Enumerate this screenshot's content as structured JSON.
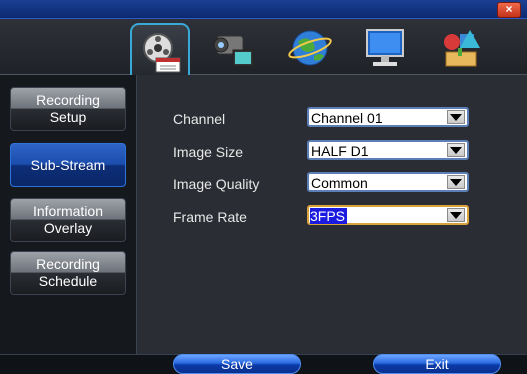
{
  "titlebar": {
    "close_glyph": "×"
  },
  "top_menu": [
    {
      "icon": "record-setup-icon",
      "active": true
    },
    {
      "icon": "camera-icon",
      "active": false
    },
    {
      "icon": "network-globe-icon",
      "active": false
    },
    {
      "icon": "monitor-icon",
      "active": false
    },
    {
      "icon": "tools-icon",
      "active": false
    }
  ],
  "sidebar": {
    "items": [
      {
        "line1": "Recording",
        "line2": "Setup",
        "active": false
      },
      {
        "line1": "Sub-Stream",
        "line2": "",
        "active": true
      },
      {
        "line1": "Information",
        "line2": "Overlay",
        "active": false
      },
      {
        "line1": "Recording",
        "line2": "Schedule",
        "active": false
      }
    ]
  },
  "form": {
    "rows": [
      {
        "label": "Channel",
        "value": "Channel 01"
      },
      {
        "label": "Image Size",
        "value": "HALF D1"
      },
      {
        "label": "Image Quality",
        "value": "Common"
      },
      {
        "label": "Frame Rate",
        "value": "3FPS",
        "focused": true
      }
    ]
  },
  "buttons": {
    "save": "Save",
    "exit": "Exit"
  },
  "colors": {
    "accent": "#39a9d8",
    "selected_value_bg": "#1a1ae0",
    "button_blue": "#2a6ae0"
  }
}
